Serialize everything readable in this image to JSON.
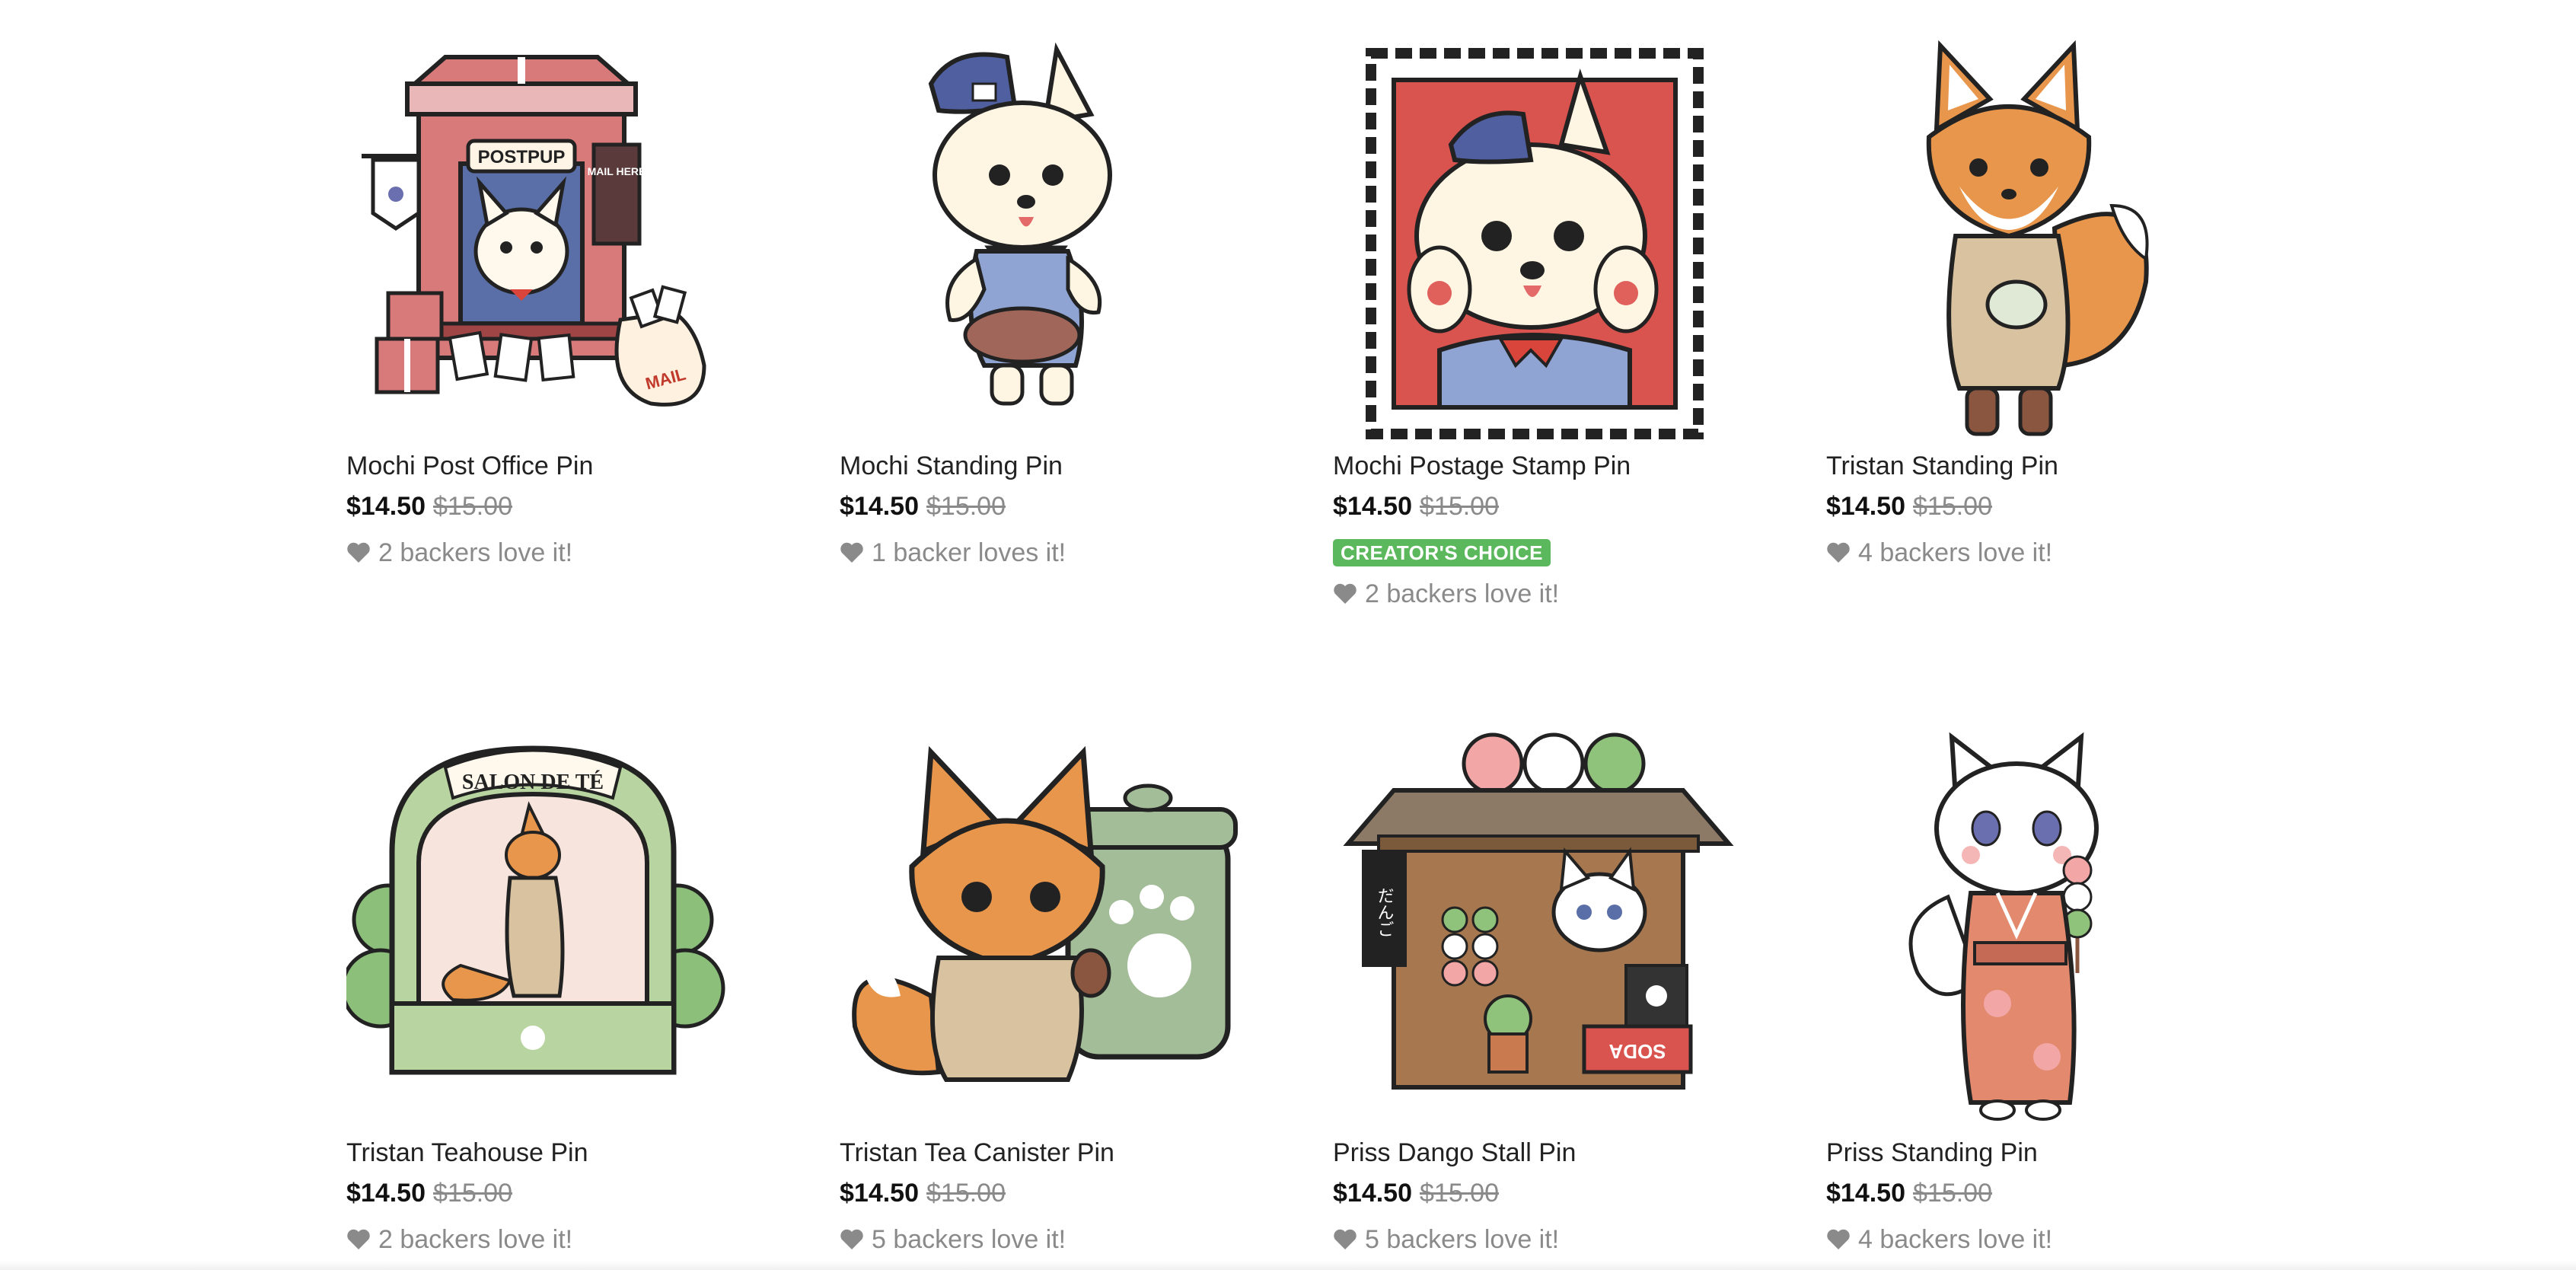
{
  "products": [
    {
      "title": "Mochi Post Office Pin",
      "price": "$14.50",
      "original_price": "$15.00",
      "backers": "2 backers love it!",
      "badge": "",
      "art_icon": "post-office-pin-art"
    },
    {
      "title": "Mochi Standing Pin",
      "price": "$14.50",
      "original_price": "$15.00",
      "backers": "1 backer loves it!",
      "badge": "",
      "art_icon": "dog-standing-pin-art"
    },
    {
      "title": "Mochi Postage Stamp Pin",
      "price": "$14.50",
      "original_price": "$15.00",
      "backers": "2 backers love it!",
      "badge": "CREATOR'S CHOICE",
      "art_icon": "postage-stamp-pin-art"
    },
    {
      "title": "Tristan Standing Pin",
      "price": "$14.50",
      "original_price": "$15.00",
      "backers": "4 backers love it!",
      "badge": "",
      "art_icon": "fox-standing-pin-art"
    },
    {
      "title": "Tristan Teahouse Pin",
      "price": "$14.50",
      "original_price": "$15.00",
      "backers": "2 backers love it!",
      "badge": "",
      "art_icon": "teahouse-pin-art"
    },
    {
      "title": "Tristan Tea Canister Pin",
      "price": "$14.50",
      "original_price": "$15.00",
      "backers": "5 backers love it!",
      "badge": "",
      "art_icon": "tea-canister-pin-art"
    },
    {
      "title": "Priss Dango Stall Pin",
      "price": "$14.50",
      "original_price": "$15.00",
      "backers": "5 backers love it!",
      "badge": "",
      "art_icon": "dango-stall-pin-art"
    },
    {
      "title": "Priss Standing Pin",
      "price": "$14.50",
      "original_price": "$15.00",
      "backers": "4 backers love it!",
      "badge": "",
      "art_icon": "cat-standing-pin-art"
    }
  ],
  "art_text": {
    "postpup_sign": "POSTPUP",
    "mail_here_sign": "MAIL HERE",
    "mail_bag": "MAIL",
    "salon_sign": "SALON DE TÉ",
    "dango_sign": "だんご",
    "soda_sign": "SODA"
  },
  "colors": {
    "badge_green": "#5cb85c",
    "text_muted": "#8a8a8a",
    "heart_gray": "#8a8a8a"
  }
}
